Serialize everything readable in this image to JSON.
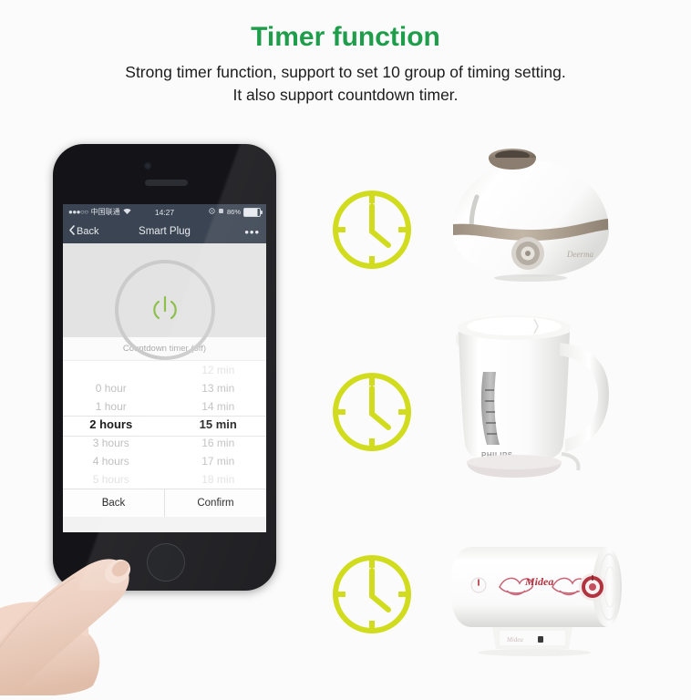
{
  "header": {
    "title": "Timer function",
    "subtitle_line1": "Strong timer function, support to set 10 group of timing setting.",
    "subtitle_line2": "It also support countdown timer.",
    "title_color": "#1e9e4a"
  },
  "phone": {
    "status_bar": {
      "signal_dots": "●●●○○",
      "carrier": "中国联通",
      "wifi_icon": "wifi-icon",
      "time": "14:27",
      "location_icon": "location-arrow-icon",
      "alarm_icon": "alarm-icon",
      "battery_percent": "86%"
    },
    "nav_bar": {
      "back_label": "Back",
      "back_icon": "chevron-left-icon",
      "title": "Smart Plug",
      "more_icon": "more-dots-icon"
    },
    "power": {
      "icon_name": "power-icon",
      "icon_color": "#8cc04a",
      "ring_color": "#cbcbcb"
    },
    "countdown_label": "Countdown timer (off)",
    "picker": {
      "hours": [
        {
          "label": "0 hour",
          "state": "normal"
        },
        {
          "label": "1 hour",
          "state": "normal"
        },
        {
          "label": "2 hours",
          "state": "selected"
        },
        {
          "label": "3 hours",
          "state": "normal"
        },
        {
          "label": "4 hours",
          "state": "normal"
        },
        {
          "label": "5 hours",
          "state": "faded"
        }
      ],
      "minutes": [
        {
          "label": "12 min",
          "state": "faded"
        },
        {
          "label": "13 min",
          "state": "normal"
        },
        {
          "label": "14 min",
          "state": "normal"
        },
        {
          "label": "15 min",
          "state": "selected"
        },
        {
          "label": "16 min",
          "state": "normal"
        },
        {
          "label": "17 min",
          "state": "normal"
        },
        {
          "label": "18 min",
          "state": "faded"
        }
      ],
      "selected_hours": "2 hours",
      "selected_minutes": "15 min"
    },
    "footer": {
      "back_label": "Back",
      "confirm_label": "Confirm"
    },
    "home_button_icon": "home-button",
    "finger_icon": "finger-touch"
  },
  "clocks": [
    {
      "name": "clock-icon-1",
      "color": "#d2dc1e"
    },
    {
      "name": "clock-icon-2",
      "color": "#d2dc1e"
    },
    {
      "name": "clock-icon-3",
      "color": "#d2dc1e"
    }
  ],
  "appliances": [
    {
      "name": "humidifier",
      "brand": "Deerma",
      "color": "#ffffff",
      "accent": "#a39383"
    },
    {
      "name": "electric-kettle",
      "brand": "PHILIPS",
      "color": "#ffffff",
      "accent": "#b9b0ab"
    },
    {
      "name": "water-heater",
      "brand": "Midea",
      "color": "#ffffff",
      "accent": "#b0333f"
    }
  ]
}
